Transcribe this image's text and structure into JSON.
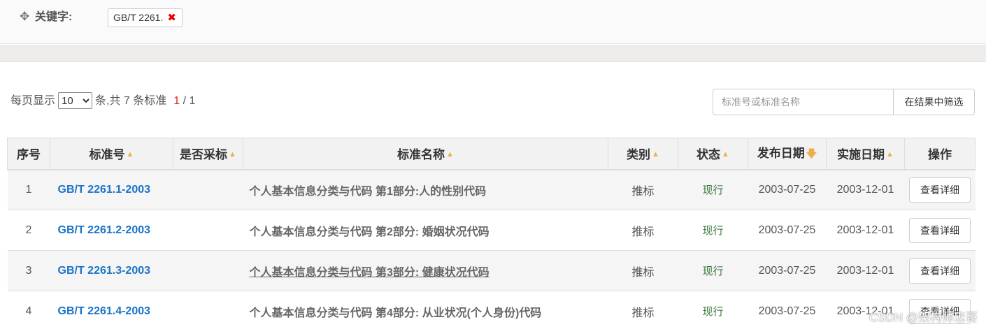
{
  "filter": {
    "icon": "move-icon",
    "label": "关键字:",
    "tag": "GB/T 2261.",
    "remove_glyph": "✖"
  },
  "pager": {
    "prefix": "每页显示",
    "page_size": "10",
    "count_text": "条,共 7 条标准",
    "current_page": "1",
    "total_pages": "/ 1"
  },
  "search": {
    "placeholder": "标准号或标准名称",
    "button": "在结果中筛选"
  },
  "table": {
    "headers": {
      "index": "序号",
      "code": "标准号",
      "adopt": "是否采标",
      "name": "标准名称",
      "category": "类别",
      "status": "状态",
      "publish": "发布日期",
      "implement": "实施日期",
      "action": "操作"
    },
    "rows": [
      {
        "index": "1",
        "code": "GB/T 2261.1-2003",
        "adopt": "",
        "name": "个人基本信息分类与代码 第1部分:人的性别代码",
        "category": "推标",
        "status": "现行",
        "publish": "2003-07-25",
        "implement": "2003-12-01",
        "action": "查看详细"
      },
      {
        "index": "2",
        "code": "GB/T 2261.2-2003",
        "adopt": "",
        "name": "个人基本信息分类与代码 第2部分: 婚姻状况代码",
        "category": "推标",
        "status": "现行",
        "publish": "2003-07-25",
        "implement": "2003-12-01",
        "action": "查看详细"
      },
      {
        "index": "3",
        "code": "GB/T 2261.3-2003",
        "adopt": "",
        "name": "个人基本信息分类与代码 第3部分: 健康状况代码",
        "category": "推标",
        "status": "现行",
        "publish": "2003-07-25",
        "implement": "2003-12-01",
        "action": "查看详细"
      },
      {
        "index": "4",
        "code": "GB/T 2261.4-2003",
        "adopt": "",
        "name": "个人基本信息分类与代码 第4部分: 从业状况(个人身份)代码",
        "category": "推标",
        "status": "现行",
        "publish": "2003-07-25",
        "implement": "2003-12-01",
        "action": "查看详细"
      }
    ]
  },
  "watermark": "CSDN @架构师忠哥",
  "colors": {
    "link": "#1a74c8",
    "sort_arrow": "#f0ad4e",
    "status": "#3c763d",
    "remove": "#e00000",
    "current_page": "#d62c1a"
  }
}
